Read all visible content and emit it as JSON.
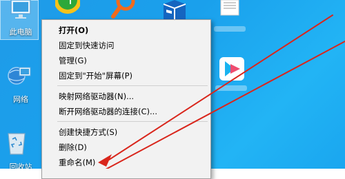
{
  "desktop": {
    "icons": {
      "this_pc": "此电脑",
      "network": "网络",
      "recycle_bin": "回收站"
    }
  },
  "context_menu": {
    "items": [
      {
        "label": "打开(O)",
        "bold": true
      },
      {
        "label": "固定到快速访问"
      },
      {
        "label": "管理(G)"
      },
      {
        "label": "固定到\"开始\"屏幕(P)"
      },
      {
        "label": "映射网络驱动器(N)..."
      },
      {
        "label": "断开网络驱动器的连接(C)..."
      },
      {
        "label": "创建快捷方式(S)"
      },
      {
        "label": "删除(D)"
      },
      {
        "label": "重命名(M)"
      }
    ]
  },
  "colors": {
    "desktop": "#1fa2ee",
    "menu_bg": "#f2f2f2",
    "annotation": "#d9261c"
  }
}
